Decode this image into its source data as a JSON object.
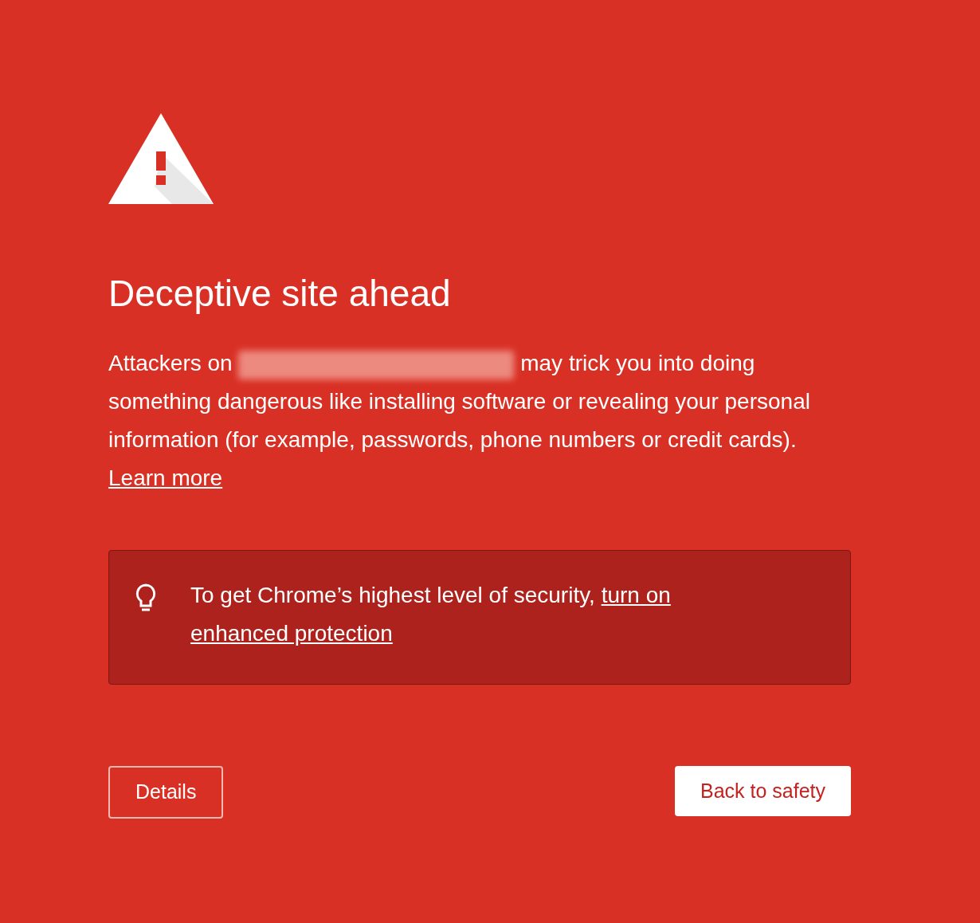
{
  "heading": "Deceptive site ahead",
  "paragraph": {
    "before": "Attackers on",
    "after": "may trick you into doing something dangerous like installing software or revealing your personal information (for example, passwords, phone numbers or credit cards).",
    "link": "Learn more"
  },
  "tip": {
    "text": "To get Chrome’s highest level of security,",
    "link_lines": [
      "turn on",
      "enhanced protection"
    ]
  },
  "buttons": [
    {
      "label": "Details",
      "kind": "outline"
    },
    {
      "label": "Back to safety",
      "kind": "primary"
    }
  ]
}
